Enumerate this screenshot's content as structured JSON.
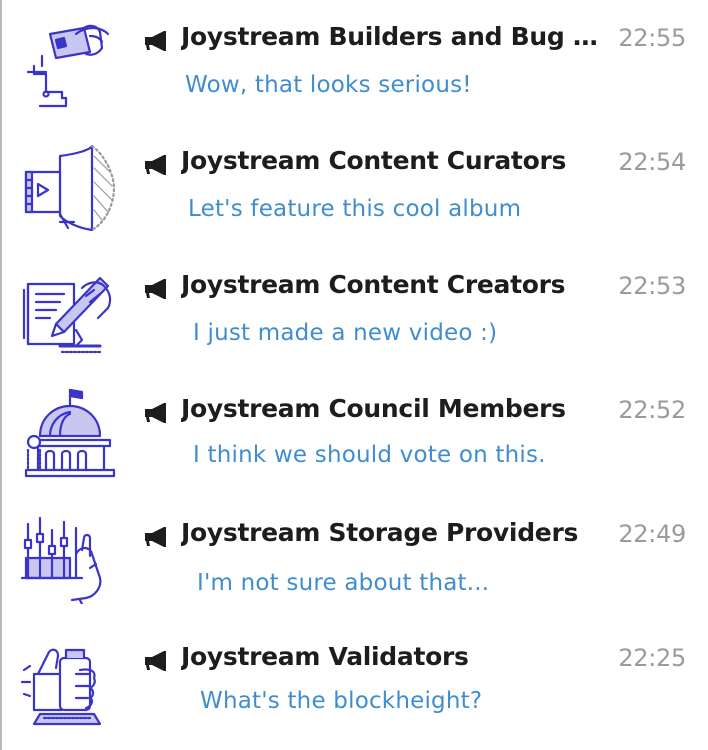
{
  "chats": [
    {
      "title": "Joystream Builders and Bug Rep...",
      "time": "22:55",
      "preview": "Wow, that looks serious!",
      "avatar_icon": "builders-hand-card-icon"
    },
    {
      "title": "Joystream Content Curators",
      "time": "22:54",
      "preview": "Let's feature this cool album",
      "avatar_icon": "curators-film-shield-icon"
    },
    {
      "title": "Joystream Content Creators",
      "time": "22:53",
      "preview": "I just made a new video :)",
      "avatar_icon": "creators-hand-pen-icon"
    },
    {
      "title": "Joystream Council Members",
      "time": "22:52",
      "preview": "I think we should vote on this.",
      "avatar_icon": "council-capitol-building-icon"
    },
    {
      "title": "Joystream Storage Providers",
      "time": "22:49",
      "preview": "I'm not sure about that...",
      "avatar_icon": "storage-sliders-hand-icon"
    },
    {
      "title": "Joystream Validators",
      "time": "22:25",
      "preview": "What's the blockheight?",
      "avatar_icon": "validators-thumbs-up-icon"
    }
  ],
  "channel_icon": "megaphone-icon",
  "colors": {
    "title": "#1d1d1d",
    "time": "#9b9b9b",
    "preview": "#3f8dd0",
    "avatar_stroke": "#3a35c8",
    "avatar_fill": "#c9c7f2"
  }
}
